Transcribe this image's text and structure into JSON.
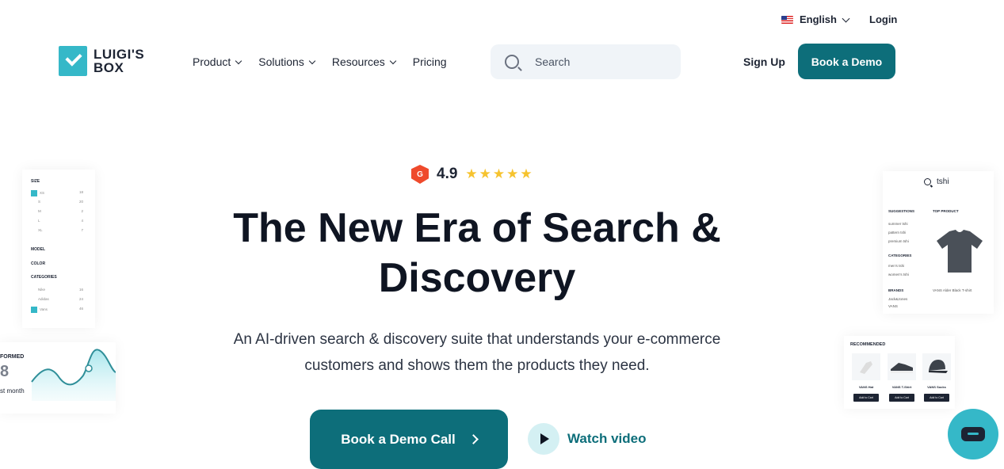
{
  "topbar": {
    "language": "English",
    "login": "Login"
  },
  "brand": {
    "line1": "LUIGI'S",
    "line2": "BOX"
  },
  "nav": {
    "items": [
      {
        "label": "Product",
        "has_dropdown": true
      },
      {
        "label": "Solutions",
        "has_dropdown": true
      },
      {
        "label": "Resources",
        "has_dropdown": true
      },
      {
        "label": "Pricing",
        "has_dropdown": false
      }
    ]
  },
  "search": {
    "placeholder": "Search"
  },
  "header": {
    "signup": "Sign Up",
    "book_demo": "Book a Demo"
  },
  "rating": {
    "badge": "G",
    "score": "4.9",
    "stars": 5
  },
  "hero": {
    "title_line1": "The New Era of Search &",
    "title_line2": "Discovery",
    "subtitle_line1": "An AI-driven search & discovery suite that understands your e-commerce",
    "subtitle_line2": "customers and shows them the products they need.",
    "cta": "Book a Demo Call",
    "watch": "Watch video"
  },
  "filter_card": {
    "size_head": "SIZE",
    "sizes": [
      [
        "XS",
        "18"
      ],
      [
        "S",
        "20"
      ],
      [
        "M",
        "2"
      ],
      [
        "L",
        "4"
      ],
      [
        "XL",
        "7"
      ]
    ],
    "model_head": "MODEL",
    "color_head": "COLOR",
    "categories_head": "CATEGORIES",
    "categories": [
      [
        "Nike",
        "16"
      ],
      [
        "Adidas",
        "24"
      ],
      [
        "Vans",
        "46"
      ]
    ]
  },
  "perf_card": {
    "label": "FORMED",
    "number": "8",
    "sub": "st month"
  },
  "search_card": {
    "query": "tshi",
    "suggestions_head": "SUGGESTIONS",
    "suggestions": [
      "summer tshi",
      "pattern tshi",
      "premium tshi"
    ],
    "categories_head": "CATEGORIES",
    "categories": [
      "men's tshi",
      "women's tshi"
    ],
    "brands_head": "BRANDS",
    "brands": [
      "Jack&Jones",
      "VANS"
    ],
    "top_product_head": "TOP PRODUCT",
    "top_product": "VANS Alder Black T-shirt"
  },
  "recommended": {
    "title": "RECOMMENDED",
    "items": [
      "VANS Hat",
      "VANS T-Shirt",
      "VANS Socks"
    ],
    "button": "Add to Cart"
  },
  "colors": {
    "primary": "#0d6e7a",
    "accent": "#35b8c8",
    "text": "#0f1522",
    "star": "#f6c32e",
    "g2": "#ef4a2c"
  }
}
